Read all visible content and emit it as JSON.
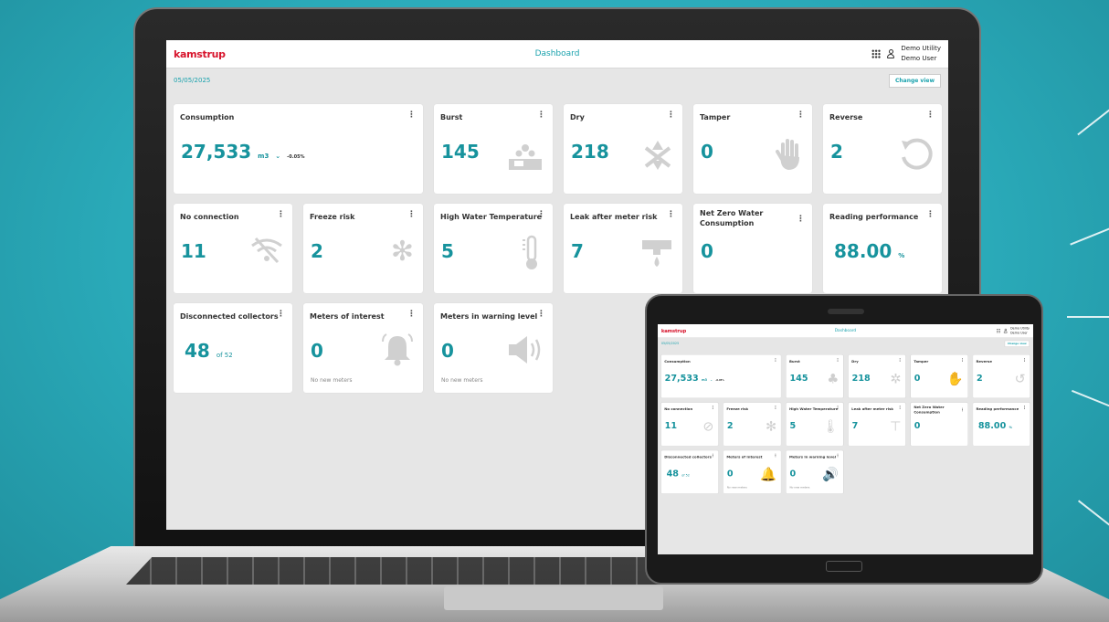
{
  "app": {
    "logo": "kamstrup",
    "title": "Dashboard",
    "utility": "Demo Utility",
    "user": "Demo User",
    "date": "05/05/2025",
    "change_view": "Change view",
    "accent": "#1aa2ad",
    "logo_color": "#d7142c"
  },
  "cards": {
    "consumption": {
      "title": "Consumption",
      "value": "27,533",
      "unit": "m3",
      "trend": "-0.05%",
      "trend_icon": "chevron-down-icon"
    },
    "burst": {
      "title": "Burst",
      "value": "145",
      "icon": "burst-icon"
    },
    "dry": {
      "title": "Dry",
      "value": "218",
      "icon": "dry-icon"
    },
    "tamper": {
      "title": "Tamper",
      "value": "0",
      "icon": "hand-icon"
    },
    "reverse": {
      "title": "Reverse",
      "value": "2",
      "icon": "reverse-icon"
    },
    "no_connection": {
      "title": "No connection",
      "value": "11",
      "icon": "no-wifi-icon"
    },
    "freeze_risk": {
      "title": "Freeze risk",
      "value": "2",
      "icon": "snowflake-icon"
    },
    "high_temp": {
      "title": "High Water Temperature",
      "value": "5",
      "icon": "thermometer-icon"
    },
    "leak": {
      "title": "Leak after meter risk",
      "value": "7",
      "icon": "leak-icon"
    },
    "net_zero": {
      "title": "Net Zero Water Consumption",
      "value": "0"
    },
    "reading": {
      "title": "Reading performance",
      "value": "88.00",
      "unit": "%"
    },
    "collectors": {
      "title": "Disconnected collectors",
      "value": "48",
      "suffix": "of 52"
    },
    "interest": {
      "title": "Meters of interest",
      "value": "0",
      "note": "No new meters",
      "icon": "bell-icon"
    },
    "warning": {
      "title": "Meters in warning level",
      "value": "0",
      "note": "No new meters",
      "icon": "speaker-icon"
    }
  },
  "kebab": "⋮"
}
